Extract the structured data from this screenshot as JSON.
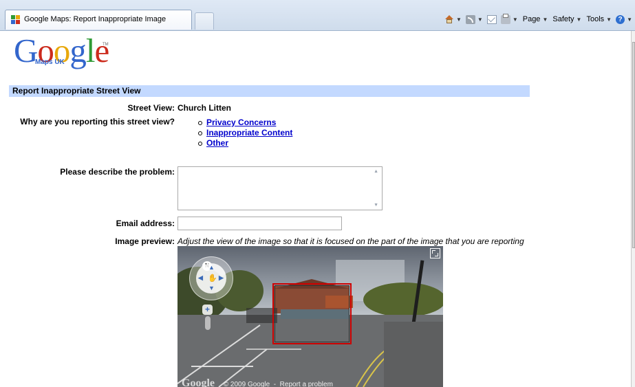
{
  "browser": {
    "tab_title": "Google Maps: Report Inappropriate Image",
    "commands": {
      "page": "Page",
      "safety": "Safety",
      "tools": "Tools",
      "help": "?"
    }
  },
  "logo": {
    "letters": [
      "G",
      "o",
      "o",
      "g",
      "l",
      "e"
    ],
    "subtitle": "Maps UK"
  },
  "form": {
    "header": "Report Inappropriate Street View",
    "street_view_label": "Street View:",
    "street_view_value": "Church Litten",
    "reason_label": "Why are you reporting this street view?",
    "reasons": [
      "Privacy Concerns",
      "Inappropriate Content",
      "Other"
    ],
    "describe_label": "Please describe the problem:",
    "describe_value": "",
    "email_label": "Email address:",
    "email_value": "",
    "preview_label": "Image preview:",
    "preview_note": "Adjust the view of the image so that it is focused on the part of the image that you are reporting"
  },
  "streetview": {
    "compass": "N",
    "zoom_in": "+",
    "footer_logo": "Google",
    "copyright": "© 2009 Google",
    "report_link": "Report a problem"
  }
}
